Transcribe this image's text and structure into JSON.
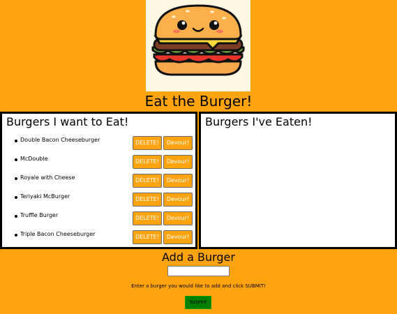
{
  "header": {
    "logo_icon": "burger-logo-icon",
    "title": "Eat the Burger!"
  },
  "to_eat": {
    "heading": "Burgers I want to Eat!",
    "delete_label": "DELETE!",
    "devour_label": "Devour!",
    "items": [
      {
        "name": "Double Bacon Cheeseburger"
      },
      {
        "name": "McDouble"
      },
      {
        "name": "Royale with Cheese"
      },
      {
        "name": "Teriyaki McBurger"
      },
      {
        "name": "Truffle Burger"
      },
      {
        "name": "Triple Bacon Cheeseburger"
      }
    ]
  },
  "eaten": {
    "heading": "Burgers I've Eaten!",
    "items": []
  },
  "add_form": {
    "heading": "Add a Burger",
    "input_value": "",
    "hint": "Enter a burger you would like to add and click SUBMIT!",
    "submit_label": "Submit"
  },
  "colors": {
    "page_background": "#FFA30E",
    "button_background": "#FFA30E",
    "submit_background": "#008000"
  }
}
